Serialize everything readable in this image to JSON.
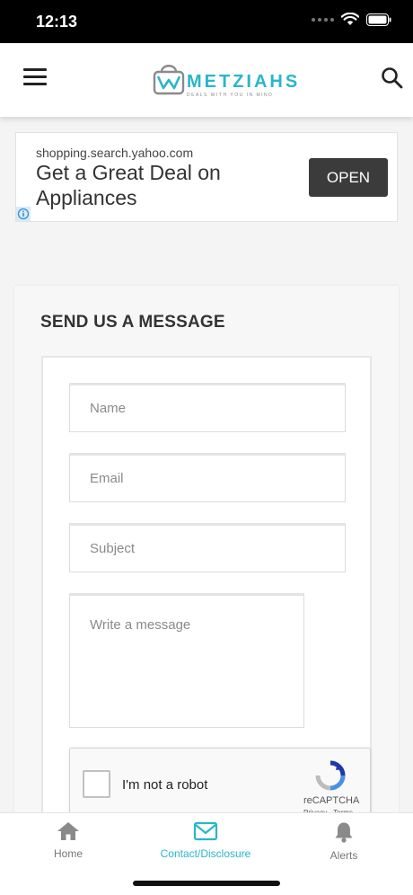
{
  "status_bar": {
    "time": "12:13"
  },
  "header": {
    "logo_text": "METZIAHS",
    "logo_tagline": "DEALS WITH YOU IN MIND",
    "menu_icon": "hamburger-icon",
    "search_icon": "search-icon"
  },
  "ad": {
    "source": "shopping.search.yahoo.com",
    "headline": "Get a Great Deal on Appliances",
    "button_label": "OPEN",
    "info_icon": "info-icon"
  },
  "contact_form": {
    "title": "SEND US A MESSAGE",
    "name_placeholder": "Name",
    "email_placeholder": "Email",
    "subject_placeholder": "Subject",
    "message_placeholder": "Write a message",
    "recaptcha": {
      "label": "I'm not a robot",
      "brand": "reCAPTCHA",
      "links": "Privacy - Terms"
    }
  },
  "tab_bar": {
    "tabs": [
      {
        "label": "Home",
        "icon": "home-icon",
        "active": false
      },
      {
        "label": "Contact/Disclosure",
        "icon": "envelope-icon",
        "active": true
      },
      {
        "label": "Alerts",
        "icon": "bell-icon",
        "active": false
      }
    ]
  },
  "colors": {
    "brand": "#29b6c9",
    "ad_button": "#3b3b3b",
    "status_bar": "#000000"
  }
}
